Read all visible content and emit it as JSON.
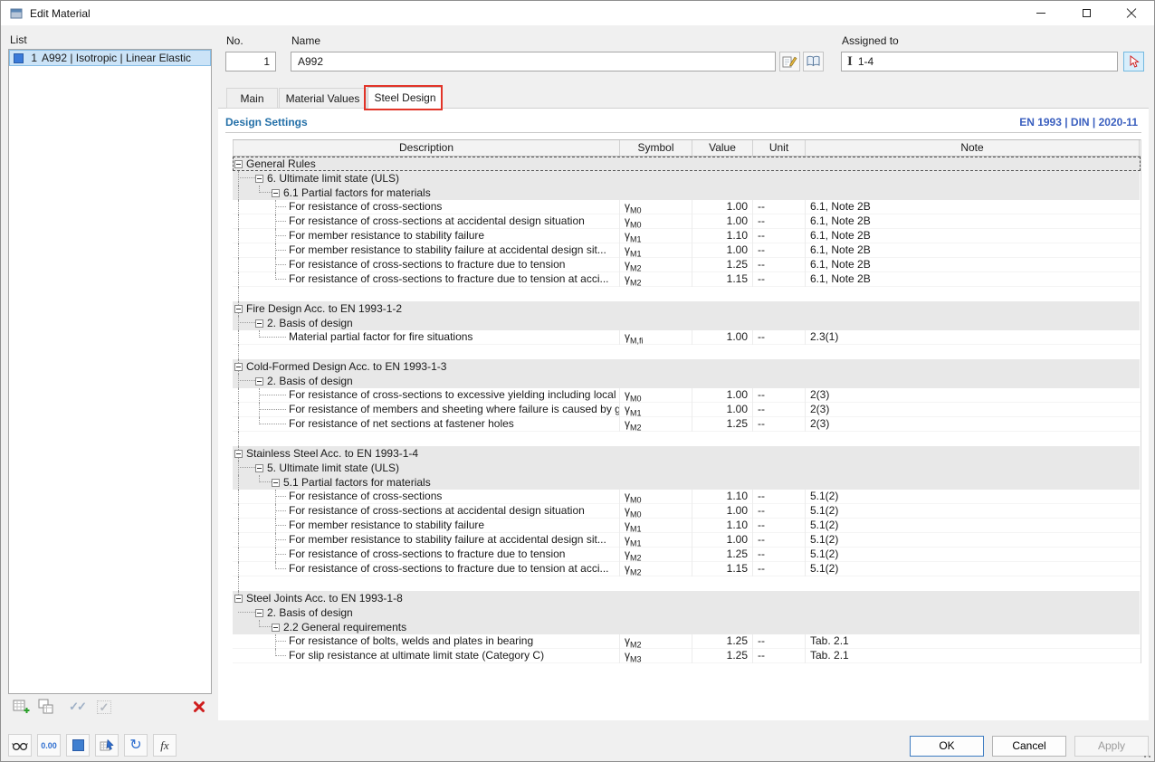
{
  "window": {
    "title": "Edit Material"
  },
  "colors": {
    "accent_blue": "#2470a8",
    "norm_blue": "#3a5fbf",
    "selection_bg": "#cbe3f7",
    "group_row_bg": "#e8e8e8",
    "annotation_red": "#e23428",
    "delete_red": "#cf1d1d",
    "swatch_blue": "#3a7ad9"
  },
  "icons": {
    "section": "I",
    "checks": "✓✓",
    "check_single": "✓",
    "refresh": "↻",
    "formula": "fx",
    "units": "0.00"
  },
  "list_panel": {
    "label": "List",
    "items": [
      {
        "no": "1",
        "name": "A992 | Isotropic | Linear Elastic",
        "selected": true
      }
    ]
  },
  "fields": {
    "no": {
      "label": "No.",
      "value": "1"
    },
    "name": {
      "label": "Name",
      "value": "A992"
    },
    "assigned": {
      "label": "Assigned to",
      "value": "1-4"
    }
  },
  "tabs": [
    {
      "label": "Main",
      "active": false
    },
    {
      "label": "Material Values",
      "active": false
    },
    {
      "label": "Steel Design",
      "active": true
    }
  ],
  "design": {
    "title": "Design Settings",
    "standard": "EN 1993 | DIN | 2020-11"
  },
  "table": {
    "columns": [
      "Description",
      "Symbol",
      "Value",
      "Unit",
      "Note"
    ],
    "rows": [
      {
        "kind": "group",
        "level": 0,
        "text": "General Rules",
        "focused": true
      },
      {
        "kind": "group",
        "level": 1,
        "text": "6. Ultimate limit state (ULS)"
      },
      {
        "kind": "group",
        "level": 2,
        "text": "6.1 Partial factors for materials"
      },
      {
        "kind": "item",
        "text": "For resistance of cross-sections",
        "sym": "γ",
        "sub": "M0",
        "value": "1.00",
        "unit": "--",
        "note": "6.1, Note 2B"
      },
      {
        "kind": "item",
        "text": "For resistance of cross-sections at accidental design situation",
        "sym": "γ",
        "sub": "M0",
        "value": "1.00",
        "unit": "--",
        "note": "6.1, Note 2B"
      },
      {
        "kind": "item",
        "text": "For member resistance to stability failure",
        "sym": "γ",
        "sub": "M1",
        "value": "1.10",
        "unit": "--",
        "note": "6.1, Note 2B"
      },
      {
        "kind": "item",
        "text": "For member resistance to stability failure at accidental design sit...",
        "sym": "γ",
        "sub": "M1",
        "value": "1.00",
        "unit": "--",
        "note": "6.1, Note 2B"
      },
      {
        "kind": "item",
        "text": "For resistance of cross-sections to fracture due to tension",
        "sym": "γ",
        "sub": "M2",
        "value": "1.25",
        "unit": "--",
        "note": "6.1, Note 2B"
      },
      {
        "kind": "item",
        "text": "For resistance of cross-sections to fracture due to tension at acci...",
        "sym": "γ",
        "sub": "M2",
        "value": "1.15",
        "unit": "--",
        "note": "6.1, Note 2B"
      },
      {
        "kind": "spacer"
      },
      {
        "kind": "group",
        "level": 0,
        "text": "Fire Design Acc. to EN 1993-1-2"
      },
      {
        "kind": "group",
        "level": 1,
        "text": "2. Basis of design"
      },
      {
        "kind": "item",
        "text": "Material partial factor for fire situations",
        "sym": "γ",
        "sub": "M,fi",
        "value": "1.00",
        "unit": "--",
        "note": "2.3(1)"
      },
      {
        "kind": "spacer"
      },
      {
        "kind": "group",
        "level": 0,
        "text": "Cold-Formed Design Acc. to EN 1993-1-3"
      },
      {
        "kind": "group",
        "level": 1,
        "text": "2. Basis of design"
      },
      {
        "kind": "item",
        "text": "For resistance of cross-sections to excessive yielding including local ...",
        "sym": "γ",
        "sub": "M0",
        "value": "1.00",
        "unit": "--",
        "note": "2(3)"
      },
      {
        "kind": "item",
        "text": "For resistance of members and sheeting where failure is caused by gl...",
        "sym": "γ",
        "sub": "M1",
        "value": "1.00",
        "unit": "--",
        "note": "2(3)"
      },
      {
        "kind": "item",
        "text": "For resistance of net sections at fastener holes",
        "sym": "γ",
        "sub": "M2",
        "value": "1.25",
        "unit": "--",
        "note": "2(3)"
      },
      {
        "kind": "spacer"
      },
      {
        "kind": "group",
        "level": 0,
        "text": "Stainless Steel Acc. to EN 1993-1-4"
      },
      {
        "kind": "group",
        "level": 1,
        "text": "5. Ultimate limit state (ULS)"
      },
      {
        "kind": "group",
        "level": 2,
        "text": "5.1 Partial factors for materials"
      },
      {
        "kind": "item",
        "text": "For resistance of cross-sections",
        "sym": "γ",
        "sub": "M0",
        "value": "1.10",
        "unit": "--",
        "note": "5.1(2)"
      },
      {
        "kind": "item",
        "text": "For resistance of cross-sections at accidental design situation",
        "sym": "γ",
        "sub": "M0",
        "value": "1.00",
        "unit": "--",
        "note": "5.1(2)"
      },
      {
        "kind": "item",
        "text": "For member resistance to stability failure",
        "sym": "γ",
        "sub": "M1",
        "value": "1.10",
        "unit": "--",
        "note": "5.1(2)"
      },
      {
        "kind": "item",
        "text": "For member resistance to stability failure at accidental design sit...",
        "sym": "γ",
        "sub": "M1",
        "value": "1.00",
        "unit": "--",
        "note": "5.1(2)"
      },
      {
        "kind": "item",
        "text": "For resistance of cross-sections to fracture due to tension",
        "sym": "γ",
        "sub": "M2",
        "value": "1.25",
        "unit": "--",
        "note": "5.1(2)"
      },
      {
        "kind": "item",
        "text": "For resistance of cross-sections to fracture due to tension at acci...",
        "sym": "γ",
        "sub": "M2",
        "value": "1.15",
        "unit": "--",
        "note": "5.1(2)"
      },
      {
        "kind": "spacer"
      },
      {
        "kind": "group",
        "level": 0,
        "text": "Steel Joints Acc. to EN 1993-1-8"
      },
      {
        "kind": "group",
        "level": 1,
        "text": "2. Basis of design"
      },
      {
        "kind": "group",
        "level": 2,
        "text": "2.2 General requirements"
      },
      {
        "kind": "item",
        "text": "For resistance of bolts, welds and plates in bearing",
        "sym": "γ",
        "sub": "M2",
        "value": "1.25",
        "unit": "--",
        "note": "Tab. 2.1"
      },
      {
        "kind": "item",
        "text": "For slip resistance at ultimate limit state (Category C)",
        "sym": "γ",
        "sub": "M3",
        "value": "1.25",
        "unit": "--",
        "note": "Tab. 2.1"
      }
    ]
  },
  "footer": {
    "ok": "OK",
    "cancel": "Cancel",
    "apply": "Apply"
  }
}
